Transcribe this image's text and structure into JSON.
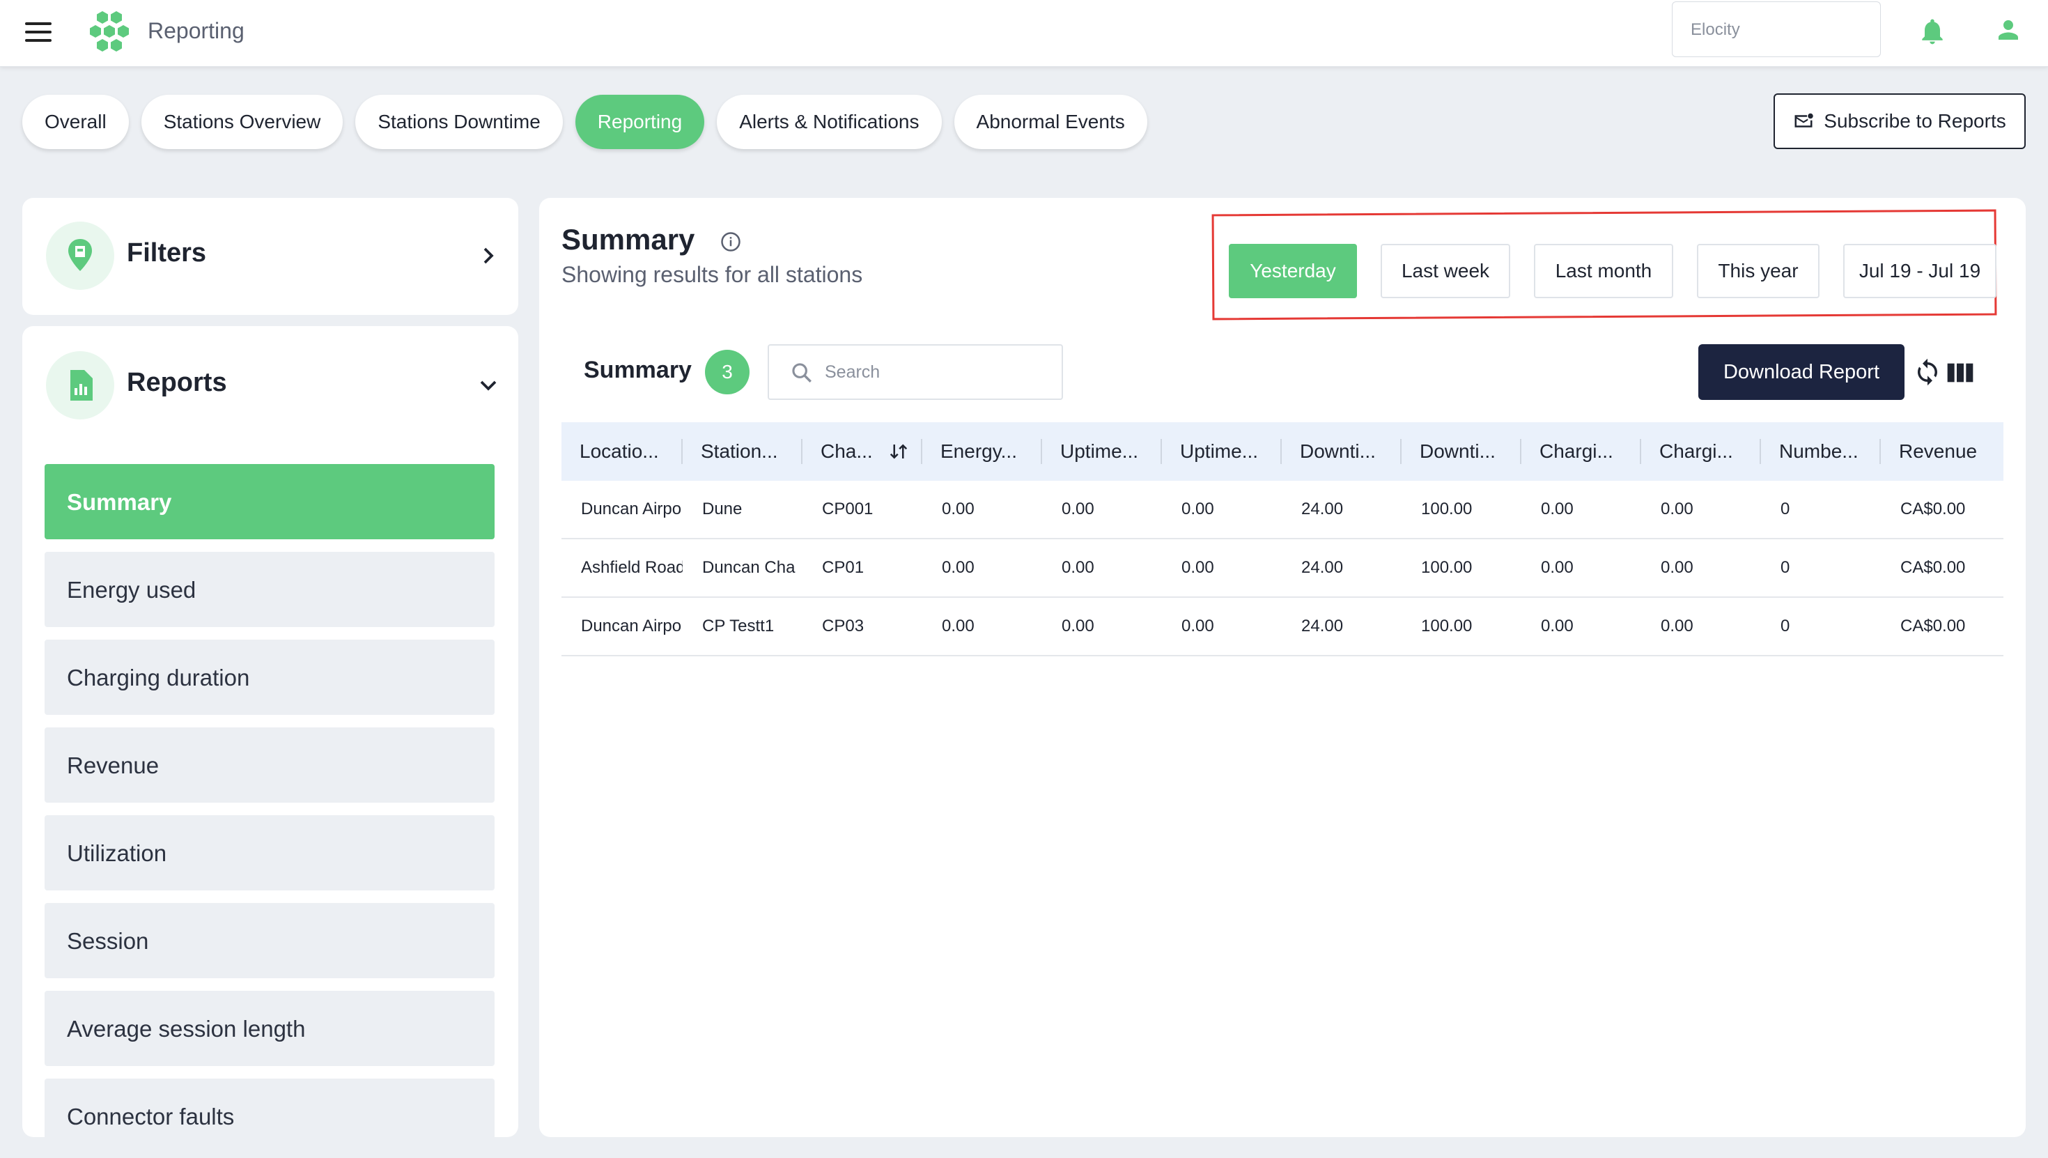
{
  "header": {
    "app_title": "Reporting",
    "org_select_value": "Elocity",
    "icons": {
      "menu": "hamburger-icon",
      "logo": "hexagon-logo",
      "notifications": "bell-icon",
      "user": "user-icon"
    },
    "accent_color": "#5dca7e"
  },
  "tabs": [
    {
      "label": "Overall",
      "active": false
    },
    {
      "label": "Stations Overview",
      "active": false
    },
    {
      "label": "Stations Downtime",
      "active": false
    },
    {
      "label": "Reporting",
      "active": true
    },
    {
      "label": "Alerts & Notifications",
      "active": false
    },
    {
      "label": "Abnormal Events",
      "active": false
    }
  ],
  "subscribe_label": "Subscribe to Reports",
  "sidebar": {
    "filters_title": "Filters",
    "reports_title": "Reports",
    "items": [
      {
        "label": "Summary",
        "active": true
      },
      {
        "label": "Energy used",
        "active": false
      },
      {
        "label": "Charging duration",
        "active": false
      },
      {
        "label": "Revenue",
        "active": false
      },
      {
        "label": "Utilization",
        "active": false
      },
      {
        "label": "Session",
        "active": false
      },
      {
        "label": "Average session length",
        "active": false
      },
      {
        "label": "Connector faults",
        "active": false
      }
    ]
  },
  "summary": {
    "title": "Summary",
    "subtitle": "Showing results for all stations",
    "ranges": [
      {
        "label": "Yesterday",
        "active": true
      },
      {
        "label": "Last week",
        "active": false
      },
      {
        "label": "Last month",
        "active": false
      },
      {
        "label": "This year",
        "active": false
      },
      {
        "label": "Jul 19 - Jul 19",
        "active": false
      }
    ]
  },
  "table": {
    "title": "Summary",
    "count": "3",
    "search_placeholder": "Search",
    "download_label": "Download Report",
    "columns": [
      "Locatio...",
      "Station...",
      "Cha...",
      "Energy...",
      "Uptime...",
      "Uptime...",
      "Downti...",
      "Downti...",
      "Chargi...",
      "Chargi...",
      "Numbe...",
      "Revenue"
    ],
    "rows": [
      [
        "Duncan Airpo",
        "Dune",
        "CP001",
        "0.00",
        "0.00",
        "0.00",
        "24.00",
        "100.00",
        "0.00",
        "0.00",
        "0",
        "CA$0.00"
      ],
      [
        "Ashfield Road",
        "Duncan Cha",
        "CP01",
        "0.00",
        "0.00",
        "0.00",
        "24.00",
        "100.00",
        "0.00",
        "0.00",
        "0",
        "CA$0.00"
      ],
      [
        "Duncan Airpo",
        "CP Testt1",
        "CP03",
        "0.00",
        "0.00",
        "0.00",
        "24.00",
        "100.00",
        "0.00",
        "0.00",
        "0",
        "CA$0.00"
      ]
    ]
  }
}
